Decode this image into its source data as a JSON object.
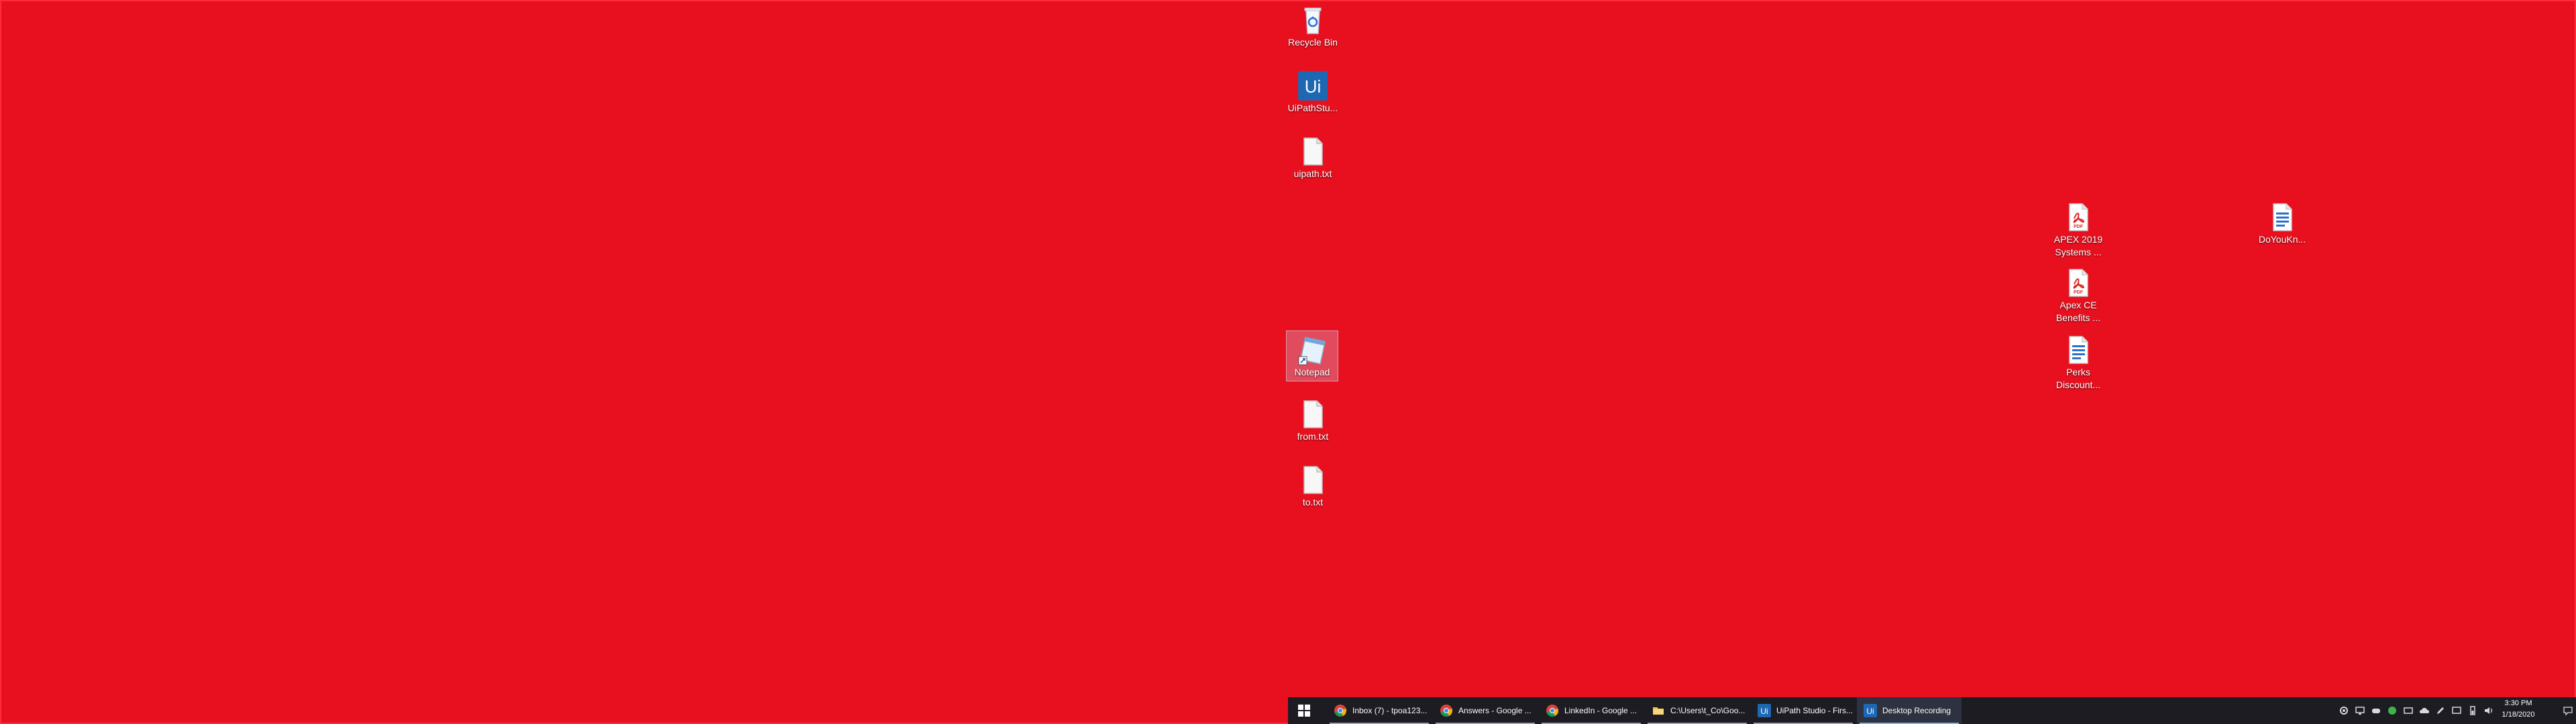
{
  "desktop": {
    "background_color": "#e8101f",
    "icons": [
      {
        "label": "Recycle Bin",
        "icon": "recycle-bin-icon"
      },
      {
        "label": "UiPathStu...",
        "icon": "uipath-studio-icon"
      },
      {
        "label": "uipath.txt",
        "icon": "text-file-icon"
      },
      {
        "label": "Notepad",
        "icon": "notepad-shortcut-icon"
      },
      {
        "label": "from.txt",
        "icon": "text-file-icon"
      },
      {
        "label": "to.txt",
        "icon": "text-file-icon"
      },
      {
        "label": "APEX 2019 Systems ...",
        "icon": "pdf-file-icon"
      },
      {
        "label": "Apex CE Benefits ...",
        "icon": "pdf-file-icon"
      },
      {
        "label": "Perks Discount...",
        "icon": "word-document-icon"
      },
      {
        "label": "DoYouKn...",
        "icon": "word-document-icon"
      }
    ]
  },
  "taskbar": {
    "start_icon": "windows-start-icon",
    "items": [
      {
        "label": "Inbox (7) - tpoa123...",
        "icon": "chrome-icon"
      },
      {
        "label": "Answers - Google ...",
        "icon": "chrome-icon"
      },
      {
        "label": "LinkedIn - Google ...",
        "icon": "chrome-icon"
      },
      {
        "label": "C:\\Users\\t_Co\\Goo...",
        "icon": "file-explorer-icon"
      },
      {
        "label": "UiPath Studio - Firs...",
        "icon": "uipath-studio-icon"
      },
      {
        "label": "Desktop Recording",
        "icon": "uipath-studio-icon"
      }
    ],
    "tray_icons": [
      "gear-icon",
      "monitor-icon",
      "controller-icon",
      "chat-icon",
      "network-icon",
      "cloud-icon",
      "pen-icon",
      "display-icon",
      "battery-icon",
      "volume-icon"
    ],
    "clock": {
      "time": "3:30 PM",
      "date": "1/18/2020"
    },
    "notification_icon": "action-center-icon"
  }
}
